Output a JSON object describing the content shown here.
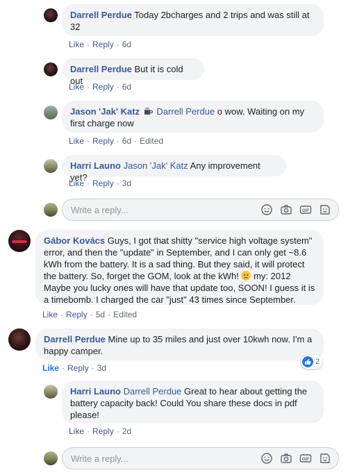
{
  "comments": [
    {
      "author": "Darrell Perdue",
      "tag": "",
      "text": "Today 2bcharges and 2 trips and was still at 32",
      "like": "Like",
      "reply": "Reply",
      "time": "6d",
      "edited": ""
    },
    {
      "author": "Darrell Perdue",
      "tag": "",
      "text": "But it is cold out",
      "like": "Like",
      "reply": "Reply",
      "time": "6d",
      "edited": ""
    },
    {
      "author": "Jason 'Jak' Katz",
      "tag": "Darrell Perdue",
      "text": "o wow. Waiting on my first charge now",
      "like": "Like",
      "reply": "Reply",
      "time": "6d",
      "edited": "Edited"
    },
    {
      "author": "Harri Launo",
      "tag": "Jason 'Jak' Katz",
      "text": "Any improvement yet?",
      "like": "Like",
      "reply": "Reply",
      "time": "3d",
      "edited": ""
    },
    {
      "author": "Gábor Kovács",
      "tag": "",
      "text": "Guys, I got that shitty \"service high voltage system\" error, and then the \"update\" in September, and I can only get ~8.6 kWh from the battery. It is a sad thing. But they said, it will protect the battery. So, forget the GOM, look at the kWh!",
      "text2": "my: 2012 Maybe you lucky ones will have that update too, SOON! I guess it is a timebomb. I charged the car \"just\" 43 times since September.",
      "like": "Like",
      "reply": "Reply",
      "time": "5d",
      "edited": "Edited"
    },
    {
      "author": "Darrell Perdue",
      "tag": "",
      "text": "Mine up to 35 miles and just over 10kwh now. I'm a happy camper.",
      "like": "Like",
      "reply": "Reply",
      "time": "3d",
      "edited": "",
      "reactions": "2"
    },
    {
      "author": "Harri Launo",
      "tag": "Darrell Perdue",
      "text": "Great to hear about getting the battery capacity back! Could You share these docs in pdf please!",
      "like": "Like",
      "reply": "Reply",
      "time": "2d",
      "edited": ""
    }
  ],
  "reply_box": {
    "placeholder": "Write a reply..."
  },
  "icons": [
    "emoji-icon",
    "camera-icon",
    "gif-icon",
    "sticker-icon",
    "coffee-icon",
    "thumbs-up-icon",
    "worried-face-icon"
  ],
  "colors": {
    "link": "#385898",
    "bubble": "#f2f3f5",
    "meta": "#606770",
    "accent": "#1877f2"
  }
}
